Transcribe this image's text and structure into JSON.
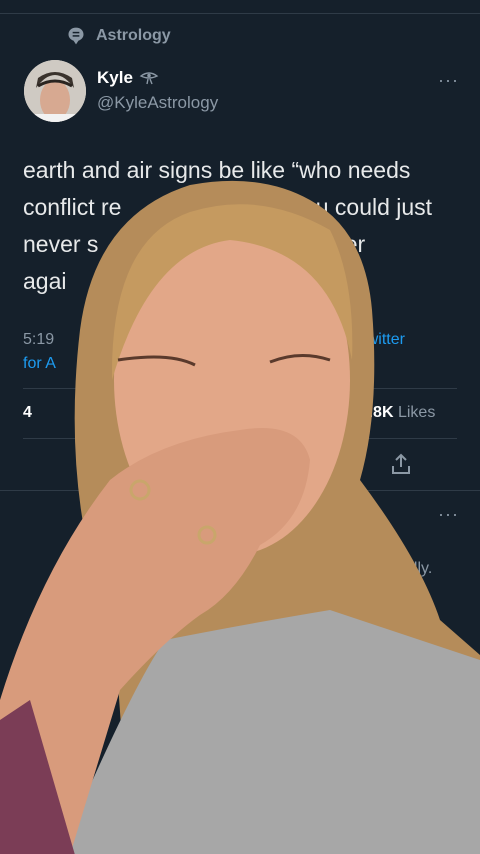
{
  "context": {
    "label": "Astrology",
    "icon": "topic-bubble-icon"
  },
  "author": {
    "name": "Kyle",
    "badge_icon": "eye-of-ra-icon",
    "handle": "@KyleAstrology"
  },
  "tweet": {
    "line1": "earth and air signs be like “who needs",
    "line2_left": "conflict re",
    "line2_right": "you could just",
    "line3_left": "never s",
    "line3_right": "ever",
    "line4_left": "agai"
  },
  "meta": {
    "time": "5:19",
    "src_suffix": "A · Twitter",
    "src_line2": "for A"
  },
  "stats": {
    "retweets_partial": "4",
    "likes_count": "21.8K",
    "likes_label": "Likes"
  },
  "more_label": "···",
  "reply_fragment": "ally."
}
